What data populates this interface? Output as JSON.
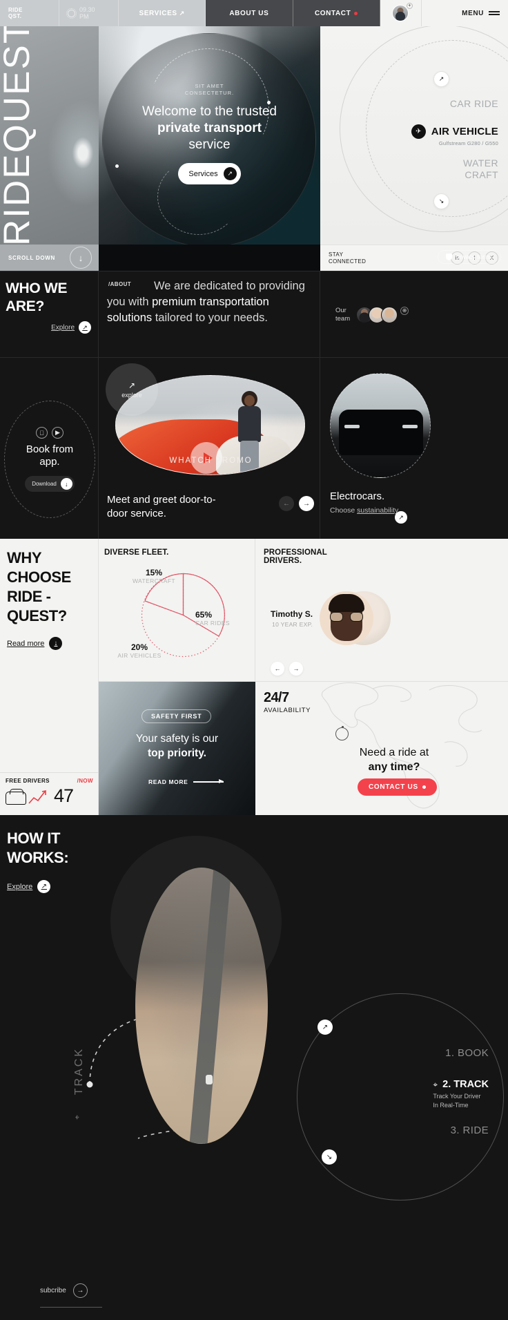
{
  "nav": {
    "brand_line1": "RIDE",
    "brand_line2": "QST.",
    "weather_time": "09.30",
    "weather_ampm": "PM",
    "links": [
      {
        "label": "SERVICES",
        "arrow": "↗"
      },
      {
        "label": "ABOUT US",
        "arrow": ""
      },
      {
        "label": "CONTACT",
        "arrow": ""
      }
    ],
    "avatar_plus": "+",
    "menu_label": "MENU"
  },
  "hero": {
    "wordmark": "RIDEQUEST",
    "kicker": "SIT AMET\nCONSECTETUR.",
    "kicker_line1": "SIT AMET",
    "kicker_line2": "CONSECTETUR.",
    "title_line1": "Welcome to the trusted",
    "title_line2": "private transport",
    "title_line3": "service",
    "cta_label": "Services",
    "cta_arrow": "↗",
    "services": [
      {
        "label": "CAR RIDE",
        "active": false,
        "sub": ""
      },
      {
        "label": "AIR VEHICLE",
        "active": true,
        "sub": "Gulfstream G280 / G550",
        "icon": "airplane-icon"
      },
      {
        "label": "WATER CRAFT",
        "active": false,
        "sub": ""
      }
    ],
    "water_line1": "WATER",
    "water_line2": "CRAFT",
    "scroll_label": "SCROLL DOWN",
    "scroll_arrow": "↓",
    "privacy_label": "privacy terms",
    "stay_line1": "STAY",
    "stay_line2": "CONNECTED",
    "socials": [
      "in",
      "f",
      "X"
    ]
  },
  "who": {
    "heading_line1": "WHO WE",
    "heading_line2": "ARE?",
    "explore_label": "Explore",
    "explore_arrow": "↗",
    "about_tag": "/ABOUT",
    "about_text_a": "We are dedicated to providing you with ",
    "about_text_b": "premium transportation solutions",
    "about_text_c": " tailored to your needs.",
    "team_line1": "Our",
    "team_line2": "team",
    "team_plus": "⊕"
  },
  "services3": {
    "app": {
      "title_line1": "Book from",
      "title_line2": "app.",
      "apple_icon": "apple-icon",
      "play_icon": "google-play-icon",
      "download_label": "Download",
      "download_arrow": "↓"
    },
    "promo": {
      "explore_label": "explore",
      "explore_arrow": "↗",
      "watch_label": "WHATCH  PROMO",
      "caption_line1": "Meet and greet door-to-",
      "caption_line2": "door service.",
      "prev_arrow": "←",
      "next_arrow": "→"
    },
    "electro": {
      "title": "Electrocars.",
      "sub_line1": "Choose",
      "sub_line2": "sustainability.",
      "arrow": "↗"
    }
  },
  "why": {
    "heading_line1": "WHY",
    "heading_line2": "CHOOSE",
    "heading_line3": "RIDE -",
    "heading_line4": "QUEST?",
    "readmore_label": "Read more",
    "readmore_arrow": "↓",
    "free_drivers_label": "FREE DRIVERS",
    "free_drivers_now": "/NOW",
    "free_drivers_count": "47",
    "fleet_heading": "DIVERSE FLEET.",
    "drivers_heading_line1": "PROFESSIONAL",
    "drivers_heading_line2": "DRIVERS.",
    "driver_name": "Timothy S.",
    "driver_exp": "10 YEAR EXP.",
    "driver_prev": "←",
    "driver_next": "→",
    "safety_pill": "SAFETY FIRST",
    "safety_line1": "Your safety is our",
    "safety_line2": "top priority.",
    "safety_more": "READ MORE",
    "avail_number": "24/7",
    "avail_label": "AVAILABILITY",
    "need_line1": "Need a ride at",
    "need_line2": "any time?",
    "contact_label": "CONTACT US"
  },
  "how": {
    "heading_line1": "HOW IT",
    "heading_line2": "WORKS:",
    "explore_label": "Explore",
    "explore_arrow": "↗",
    "track_vertical": "TRACK",
    "steps": [
      {
        "label": "1. BOOK",
        "active": false,
        "sub": ""
      },
      {
        "label": "2. TRACK",
        "active": true,
        "sub_line1": "Track Your Driver",
        "sub_line2": "In Real-Time"
      },
      {
        "label": "3. RIDE",
        "active": false,
        "sub": ""
      }
    ],
    "chip_top": "↗",
    "chip_bottom": "↘",
    "subscribe_label": "subcribe",
    "subscribe_arrow": "→"
  },
  "chart_data": {
    "type": "pie",
    "title": "DIVERSE FLEET.",
    "categories": [
      "CAR RIDES",
      "AIR VEHICLES",
      "WATERCRAFT"
    ],
    "values": [
      65,
      20,
      15
    ],
    "labels": [
      "65%",
      "20%",
      "15%"
    ],
    "unit": "%",
    "color_stroke": "#e05a6a",
    "style": "dotted-outline",
    "legend": "inline-labels"
  },
  "colors": {
    "accent_red": "#f4424c",
    "dark_bg": "#151515",
    "light_bg": "#f3f3f1",
    "pie_stroke": "#e05a6a"
  }
}
